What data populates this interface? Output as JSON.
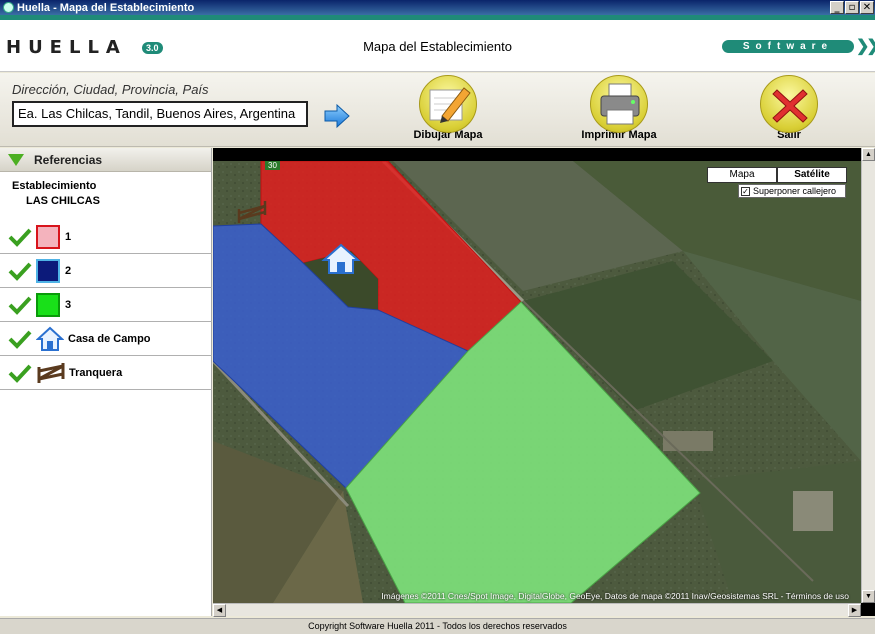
{
  "window": {
    "title": "Huella - Mapa del Establecimiento"
  },
  "header": {
    "logo": "HUELLA",
    "logo_version": "3.0",
    "title": "Mapa del Establecimiento",
    "badge": "Software"
  },
  "toolbar": {
    "address_label": "Dirección, Ciudad, Provincia, País",
    "address_value": "Ea. Las Chilcas, Tandil, Buenos Aires, Argentina",
    "draw_label": "Dibujar Mapa",
    "print_label": "Imprimir Mapa",
    "exit_label": "Salir"
  },
  "sidebar": {
    "title": "Referencias",
    "establishment_label": "Establecimiento",
    "establishment_name": "LAS CHILCAS",
    "legend": [
      {
        "label": "1",
        "color": "#f4b3bd",
        "border": "#d8141c"
      },
      {
        "label": "2",
        "color": "#0c1a7a",
        "border": "#4fb3e6"
      },
      {
        "label": "3",
        "color": "#19e019",
        "border": "#0a9a0a"
      },
      {
        "label": "Casa de Campo",
        "icon": "house-icon"
      },
      {
        "label": "Tranquera",
        "icon": "gate-icon"
      }
    ]
  },
  "map": {
    "mode_map": "Mapa",
    "mode_satellite": "Satélite",
    "active_mode": "Satélite",
    "overlay_label": "Superponer callejero",
    "overlay_checked": true,
    "road_number": "30",
    "attribution": "Imágenes ©2011 Cnes/Spot Image, DigitalGlobe, GeoEye, Datos de mapa ©2011 Inav/Geosistemas SRL - Términos de uso",
    "colors": {
      "lot1": "#e01e1e",
      "lot2": "#3a5fd0",
      "lot3": "#7de07a"
    }
  },
  "footer": {
    "text": "Copyright Software Huella 2011 - Todos los derechos reservados"
  }
}
